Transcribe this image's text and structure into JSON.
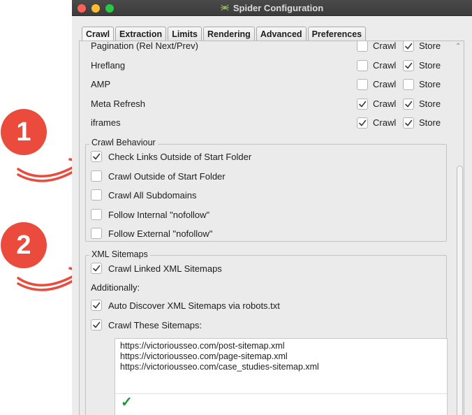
{
  "window": {
    "title": "Spider Configuration"
  },
  "tabs": [
    {
      "label": "Crawl",
      "active": true
    },
    {
      "label": "Extraction",
      "active": false
    },
    {
      "label": "Limits",
      "active": false
    },
    {
      "label": "Rendering",
      "active": false
    },
    {
      "label": "Advanced",
      "active": false
    },
    {
      "label": "Preferences",
      "active": false
    }
  ],
  "resource_rows": [
    {
      "label": "Pagination (Rel Next/Prev)",
      "crawl": false,
      "store": true
    },
    {
      "label": "Hreflang",
      "crawl": false,
      "store": true
    },
    {
      "label": "AMP",
      "crawl": false,
      "store": false
    },
    {
      "label": "Meta Refresh",
      "crawl": true,
      "store": true
    },
    {
      "label": "iframes",
      "crawl": true,
      "store": true
    }
  ],
  "column_labels": {
    "crawl": "Crawl",
    "store": "Store"
  },
  "crawl_behaviour": {
    "title": "Crawl Behaviour",
    "options": [
      {
        "label": "Check Links Outside of Start Folder",
        "checked": true
      },
      {
        "label": "Crawl Outside of Start Folder",
        "checked": false
      },
      {
        "label": "Crawl All Subdomains",
        "checked": false
      },
      {
        "label": "Follow Internal \"nofollow\"",
        "checked": false
      },
      {
        "label": "Follow External \"nofollow\"",
        "checked": false
      }
    ]
  },
  "xml_sitemaps": {
    "title": "XML Sitemaps",
    "crawl_linked": {
      "label": "Crawl Linked XML Sitemaps",
      "checked": true
    },
    "additionally": "Additionally:",
    "auto_discover": {
      "label": "Auto Discover XML Sitemaps via robots.txt",
      "checked": true
    },
    "crawl_these": {
      "label": "Crawl These Sitemaps:",
      "checked": true
    },
    "urls": [
      "https://victoriousseo.com/post-sitemap.xml",
      "https://victoriousseo.com/page-sitemap.xml",
      "https://victoriousseo.com/case_studies-sitemap.xml"
    ],
    "valid_mark": "✓"
  },
  "annotations": [
    "1",
    "2"
  ],
  "colors": {
    "badge": "#ea4b3c",
    "valid": "#1c9a2f",
    "titlebar": "#3c3c3c"
  }
}
